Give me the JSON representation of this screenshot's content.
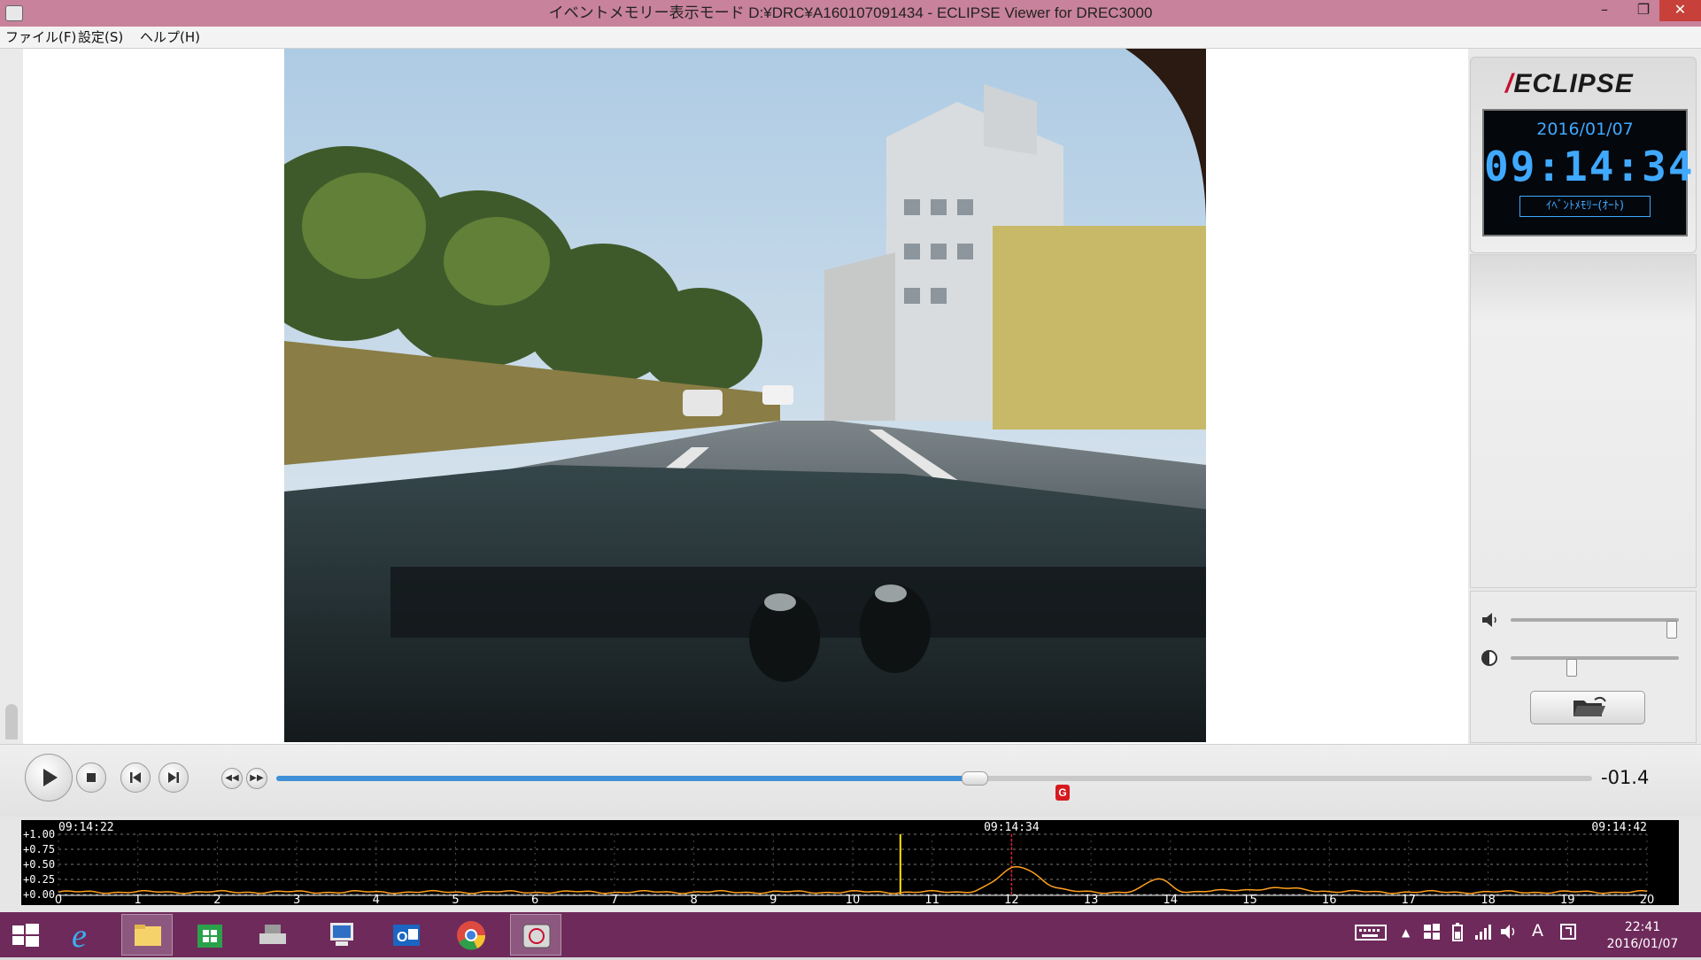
{
  "window": {
    "title": "イベントメモリー表示モード D:¥DRC¥A160107091434 - ECLIPSE Viewer for DREC3000",
    "min_glyph": "–",
    "max_glyph": "❐",
    "close_glyph": "✕"
  },
  "menu": [
    "ファイル(F)",
    "設定(S)",
    "ヘルプ(H)"
  ],
  "panel": {
    "logo": "ECLIPSE",
    "date": "2016/01/07",
    "time": "09:14:34",
    "mode": "ｲﾍﾞﾝﾄﾒﾓﾘｰ(ｵｰﾄ)",
    "volume_level": 0.98,
    "brightness_level": 0.35
  },
  "player": {
    "offset": "-01.4",
    "seek_progress": 0.53,
    "g_marker": "G"
  },
  "graph": {
    "time_left": "09:14:22",
    "time_center": "09:14:34",
    "time_right": "09:14:42",
    "y_labels": [
      "+1.00",
      "+0.75",
      "+0.50",
      "+0.25",
      "+0.00"
    ],
    "x_ticks": [
      "0",
      "1",
      "2",
      "3",
      "4",
      "5",
      "6",
      "7",
      "8",
      "9",
      "10",
      "11",
      "12",
      "13",
      "14",
      "15",
      "16",
      "17",
      "18",
      "19",
      "20"
    ],
    "cursor_x": 10.6,
    "event_x": 12.0,
    "colors": {
      "line": "#ffa020",
      "cursor": "#ffe400",
      "event": "#e0202c"
    }
  },
  "taskbar": {
    "icons": [
      "windows-start-icon",
      "internet-explorer-icon",
      "file-explorer-icon",
      "store-icon",
      "scanner-icon",
      "network-app-icon",
      "outlook-icon",
      "chrome-icon",
      "eclipse-viewer-icon"
    ],
    "ime": "A",
    "time": "22:41",
    "date": "2016/01/07"
  }
}
